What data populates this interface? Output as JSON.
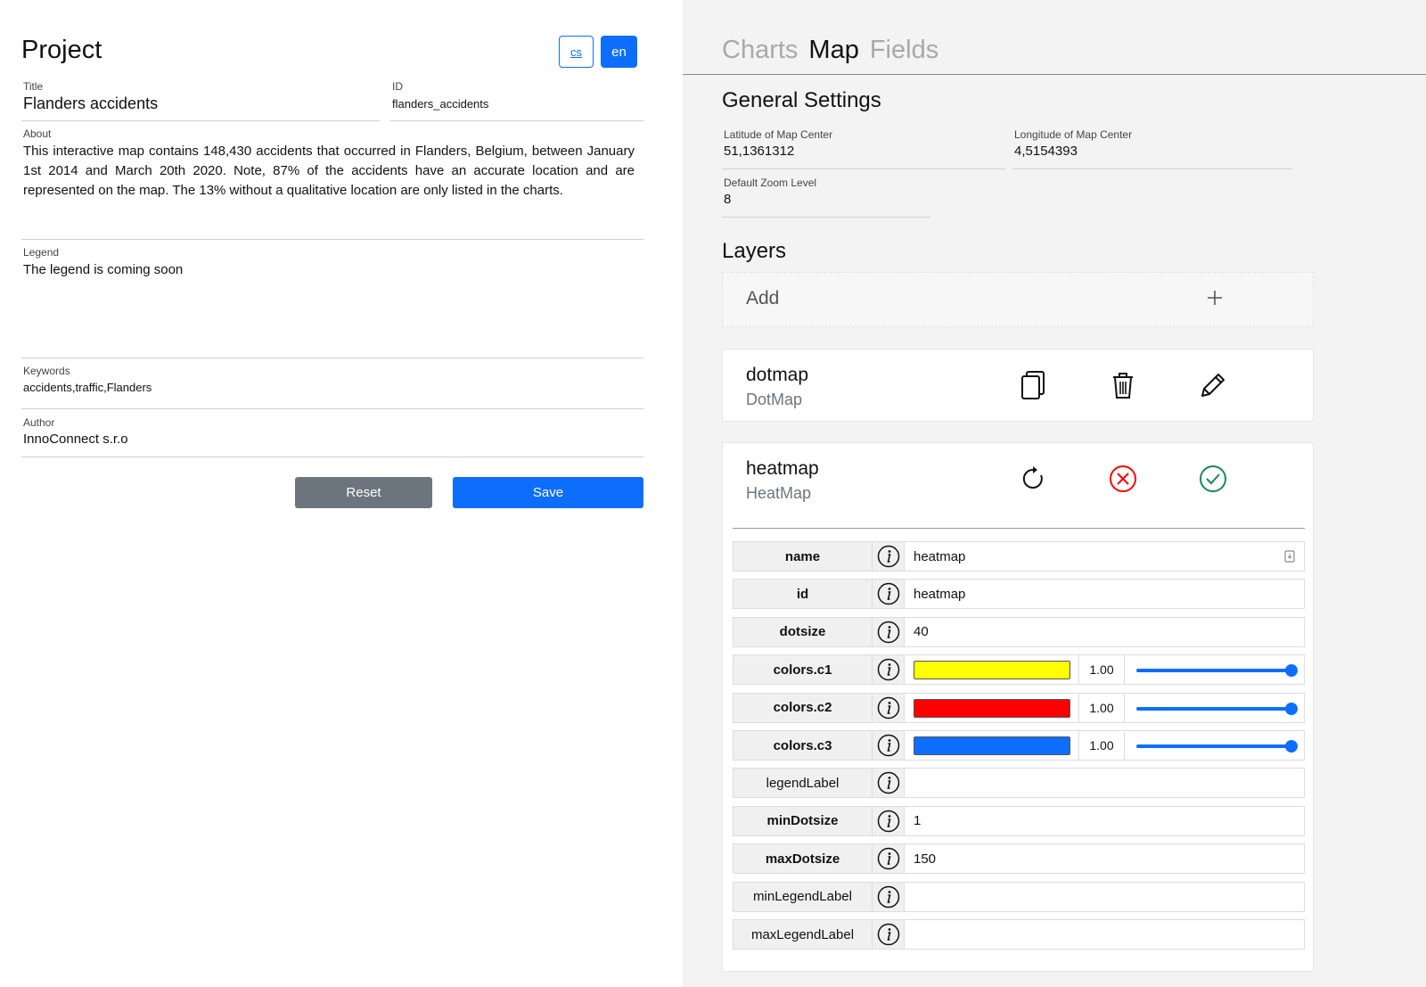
{
  "project": {
    "heading": "Project",
    "lang_cs": "cs",
    "lang_en": "en",
    "title_label": "Title",
    "title_value": "Flanders accidents",
    "id_label": "ID",
    "id_value": "flanders_accidents",
    "about_label": "About",
    "about_value": "This interactive map contains 148,430 accidents that occurred in Flanders, Belgium, between January 1st 2014 and March 20th 2020. Note, 87% of the accidents have an accurate location and are represented on the map. The 13% without a qualitative location are only listed in the charts.",
    "legend_label": "Legend",
    "legend_value": "The legend is coming soon",
    "keywords_label": "Keywords",
    "keywords_value": "accidents,traffic,Flanders",
    "author_label": "Author",
    "author_value": "InnoConnect s.r.o",
    "reset_label": "Reset",
    "save_label": "Save"
  },
  "tabs": [
    {
      "label": "Charts"
    },
    {
      "label": "Map"
    },
    {
      "label": "Fields"
    }
  ],
  "general": {
    "heading": "General Settings",
    "lat_label": "Latitude of Map Center",
    "lat_value": "51,1361312",
    "lon_label": "Longitude of Map Center",
    "lon_value": "4,5154393",
    "zoom_label": "Default Zoom Level",
    "zoom_value": "8"
  },
  "layers": {
    "heading": "Layers",
    "add_label": "Add",
    "items": [
      {
        "name": "dotmap",
        "type": "DotMap"
      },
      {
        "name": "heatmap",
        "type": "HeatMap"
      }
    ]
  },
  "params": [
    {
      "key": "name",
      "value": "heatmap"
    },
    {
      "key": "id",
      "value": "heatmap"
    },
    {
      "key": "dotsize",
      "value": "40"
    },
    {
      "key": "colors.c1",
      "color": "#ffff00",
      "alpha": "1.00",
      "level": 1.0
    },
    {
      "key": "colors.c2",
      "color": "#ff0000",
      "alpha": "1.00",
      "level": 1.0
    },
    {
      "key": "colors.c3",
      "color": "#0d6efd",
      "alpha": "1.00",
      "level": 1.0
    },
    {
      "key": "legendLabel",
      "value": ""
    },
    {
      "key": "minDotsize",
      "value": "1"
    },
    {
      "key": "maxDotsize",
      "value": "150"
    },
    {
      "key": "minLegendLabel",
      "value": ""
    },
    {
      "key": "maxLegendLabel",
      "value": ""
    }
  ],
  "colors": {
    "primary": "#0d6efd",
    "secondary": "#6c757d",
    "danger": "#ff0000",
    "success": "#198754"
  }
}
